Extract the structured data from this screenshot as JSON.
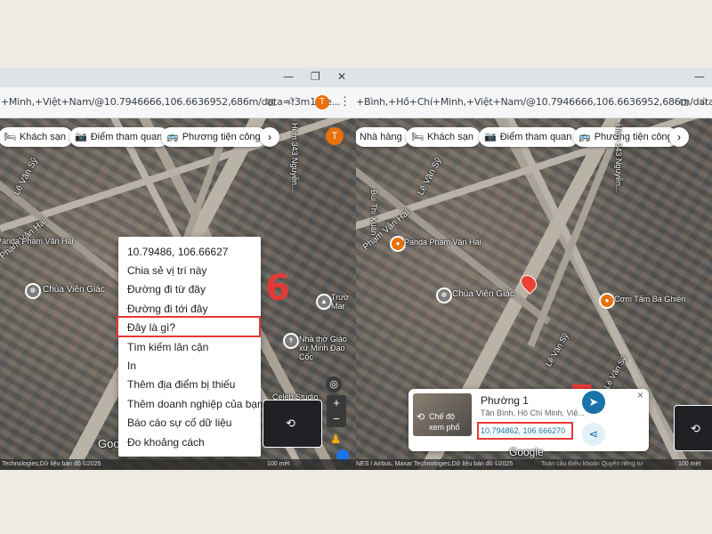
{
  "left": {
    "url": "i+Minh,+Việt+Nam/@10.7946666,106.6636952,686m/data=!3m1!1e...",
    "avatar_letter": "T",
    "chips": [
      {
        "icon": "🛏",
        "label": "Khách sạn"
      },
      {
        "icon": "📷",
        "label": "Điểm tham quan"
      },
      {
        "icon": "🚌",
        "label": "Phương tiện công c"
      }
    ],
    "map_labels": {
      "street1": "Lê Văn Sỹ",
      "street2": "Phạm Văn Hai",
      "pagoda": "Chùa Viên Giác",
      "school": "Nhà thờ Giáo xứ Minh Đạo Cốc",
      "hem": "Hẻm 343 Nguyễn...",
      "studio": "Celeb Studio",
      "truong": "Trườ Mar",
      "pandapv": "Panda Phạm Văn Hai",
      "google": "Google",
      "footer": "Technologies,Dữ liệu bản đồ ©2025",
      "scale": "100 mét"
    },
    "context_menu": {
      "coords": "10.79486, 106.66627",
      "items": [
        "Chia sẻ vị trí này",
        "Đường đi từ đây",
        "Đường đi tới đây",
        "Đây là gì?",
        "Tìm kiếm lân cận",
        "In",
        "Thêm địa điểm bị thiếu",
        "Thêm doanh nghiệp của bạn",
        "Báo cáo sự cố dữ liệu",
        "Đo khoảng cách"
      ],
      "highlighted_index": 3
    },
    "step_number": "6"
  },
  "right": {
    "url": "+Bình,+Hồ+Chí+Minh,+Việt+Nam/@10.7946666,106.6636952,686m/data=!3m1!1e...",
    "chips": [
      {
        "icon": "",
        "label": "Nhà hàng"
      },
      {
        "icon": "🛏",
        "label": "Khách sạn"
      },
      {
        "icon": "📷",
        "label": "Điểm tham quan"
      },
      {
        "icon": "🚌",
        "label": "Phương tiện công c"
      }
    ],
    "map_labels": {
      "street1": "Lê Văn Sỹ",
      "street2": "Phạm Văn Hai",
      "street3": "Lê Văn Sỹ",
      "pagoda": "Chùa Viên Giác",
      "pandapv": "Panda Phạm Văn Hai",
      "com_tam": "Cơm Tấm Ba Ghiền",
      "buithixuan": "Bùi Thị Xuân",
      "hem": "Hẻm 343 Nguyễn...",
      "hem2": "Hẻm 35 Lê Văn Sỹ",
      "footer": "NES / Airbus, Maxar Technologies,Dữ liệu bản đồ ©2025",
      "footer_links": "Toàn cầu   Điều khoản   Quyền riêng tư",
      "scale": "100 mét",
      "google": "Google"
    },
    "card": {
      "title": "Phường 1",
      "subtitle": "Tân Bình, Hồ Chí Minh, Việ...",
      "coords": "10.794862, 106.666270",
      "streetview_label": "Chế độ xem phố",
      "close": "×"
    },
    "step_number": "7"
  },
  "colors": {
    "highlight": "#e53935",
    "teal": "#1a73a8",
    "link": "#1a73e8",
    "avatar": "#e8710a"
  }
}
